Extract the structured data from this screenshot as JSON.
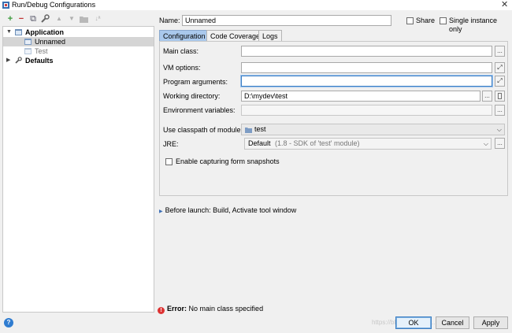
{
  "window": {
    "title": "Run/Debug Configurations",
    "close_glyph": "✕"
  },
  "toolbar": {
    "add": "+",
    "remove": "−",
    "copy": "⧉",
    "wrench": "🔧",
    "up": "▲",
    "down": "▼",
    "folder": "▬",
    "sort": "↓ª"
  },
  "tree": {
    "items": [
      {
        "label": "Application",
        "bold": true,
        "expanded": true
      },
      {
        "label": "Unnamed",
        "selected": true
      },
      {
        "label": "Test",
        "muted": true
      },
      {
        "label": "Defaults",
        "bold": true
      }
    ]
  },
  "header": {
    "name_label": "Name:",
    "name_value": "Unnamed",
    "share_label": "Share",
    "single_instance_label": "Single instance only"
  },
  "tabs": [
    {
      "label": "Configuration",
      "active": true
    },
    {
      "label": "Code Coverage"
    },
    {
      "label": "Logs"
    }
  ],
  "config": {
    "main_class_label": "Main class:",
    "main_class_value": "",
    "vm_options_label": "VM options:",
    "vm_options_value": "",
    "program_args_label": "Program arguments:",
    "program_args_value": "",
    "working_dir_label": "Working directory:",
    "working_dir_value": "D:\\mydev\\test",
    "env_vars_label": "Environment variables:",
    "env_vars_value": "",
    "classpath_label": "Use classpath of module:",
    "classpath_value": "test",
    "jre_label": "JRE:",
    "jre_value": "Default",
    "jre_detail": "(1.8 - SDK of 'test' module)",
    "form_snapshots_label": "Enable capturing form snapshots",
    "ellipsis": "...",
    "expand_glyph": "⤢"
  },
  "before_launch": {
    "label": "Before launch: Build, Activate tool window"
  },
  "error": {
    "prefix": "Error:",
    "message": "No main class specified"
  },
  "buttons": {
    "ok": "OK",
    "cancel": "Cancel",
    "apply": "Apply",
    "help": "?"
  },
  "watermark": "https://blog.csdn.net/..."
}
